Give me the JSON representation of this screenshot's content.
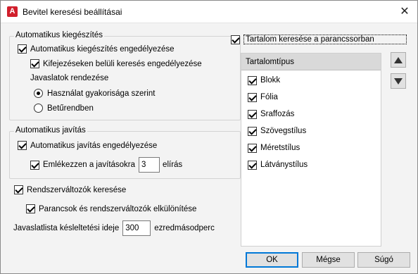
{
  "window": {
    "title": "Bevitel keresési beállításai",
    "app_icon": "autocad-app-icon",
    "close_glyph": "✕"
  },
  "autocomplete": {
    "legend": "Automatikus kiegészítés",
    "enable_label": "Automatikus kiegészítés engedélyezése",
    "enable_checked": true,
    "midstring_label": "Kifejezéseken belüli keresés engedélyezése",
    "midstring_checked": true,
    "sort_label": "Javaslatok rendezése",
    "sort_options": [
      {
        "label": "Használat gyakorisága szerint",
        "selected": true
      },
      {
        "label": "Betűrendben",
        "selected": false
      }
    ]
  },
  "autocorrect": {
    "legend": "Automatikus javítás",
    "enable_label": "Automatikus javítás engedélyezése",
    "enable_checked": true,
    "remember_label": "Emlékezzen a javításokra",
    "remember_checked": true,
    "remember_value": "3",
    "remember_suffix": "elírás"
  },
  "sysvars": {
    "search_label": "Rendszerváltozók keresése",
    "search_checked": true,
    "separate_label": "Parancsok és rendszerváltozók elkülönítése",
    "separate_checked": true
  },
  "delay": {
    "label": "Javaslatlista késleltetési ideje",
    "value": "300",
    "unit": "ezredmásodperc"
  },
  "content": {
    "search_label": "Tartalom keresése a parancssorban",
    "search_checked": true,
    "list_header": "Tartalomtípus",
    "items": [
      {
        "label": "Blokk",
        "checked": true
      },
      {
        "label": "Fólia",
        "checked": true
      },
      {
        "label": "Sraffozás",
        "checked": true
      },
      {
        "label": "Szövegstílus",
        "checked": true
      },
      {
        "label": "Méretstílus",
        "checked": true
      },
      {
        "label": "Látványstílus",
        "checked": true
      }
    ],
    "move_up_icon": "triangle-up-icon",
    "move_down_icon": "triangle-down-icon"
  },
  "buttons": {
    "ok": "OK",
    "cancel": "Mégse",
    "help": "Súgó"
  },
  "colors": {
    "app_icon_bg": "#d11f2c",
    "default_button_border": "#0078d7",
    "list_header_bg": "#d9d9d9"
  }
}
